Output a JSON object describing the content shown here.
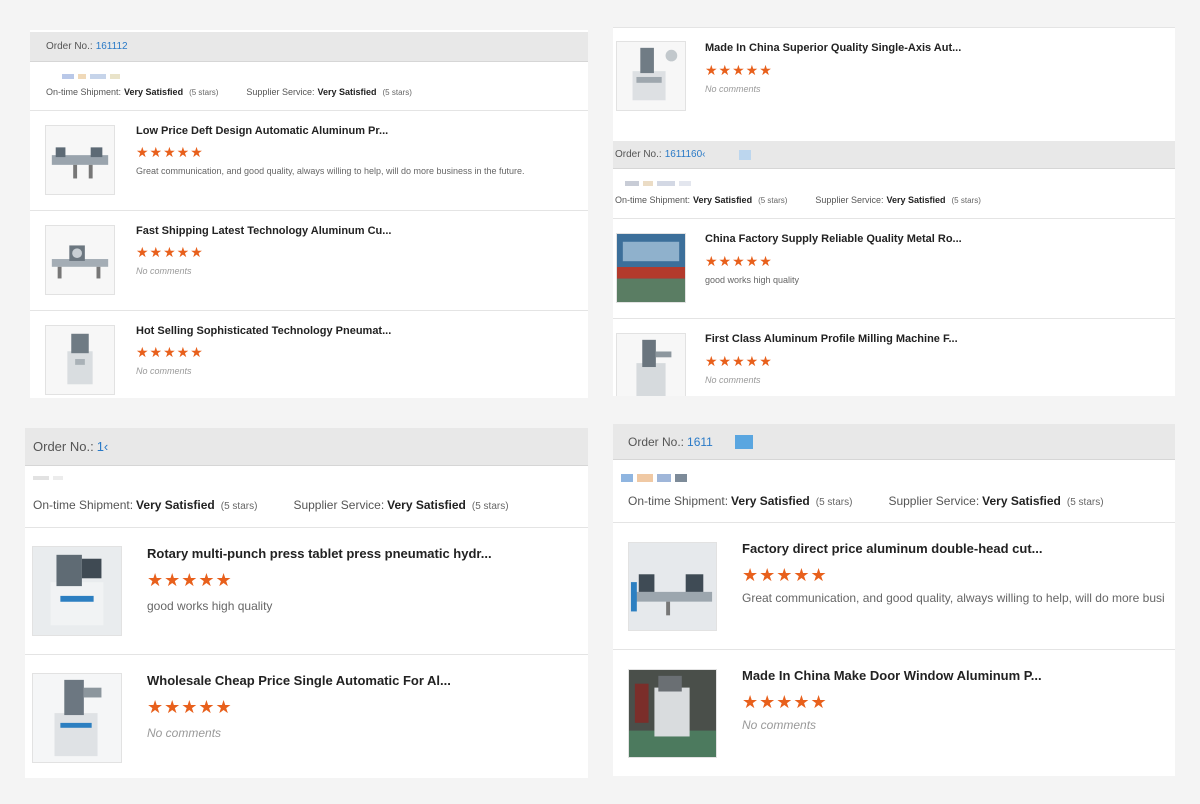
{
  "labels": {
    "order_prefix": "Order No.:",
    "ontime": "On-time Shipment:",
    "supplier": "Supplier Service:",
    "very_satisfied": "Very Satisfied",
    "five_stars": "(5 stars)",
    "star_glyphs": "★★★★★"
  },
  "panel_top_left": {
    "order_number": "161112",
    "items": [
      {
        "title": "Low Price Deft Design Automatic Aluminum Pr...",
        "comment": "Great communication, and good quality, always willing to help, will do more business in the future."
      },
      {
        "title": "Fast Shipping Latest Technology Aluminum Cu...",
        "comment": "No comments"
      },
      {
        "title": "Hot Selling Sophisticated Technology Pneumat...",
        "comment": "No comments"
      }
    ]
  },
  "panel_top_right": {
    "top_item": {
      "title": "Made In China Superior Quality Single-Axis Aut...",
      "comment": "No comments"
    },
    "order_number": "1611160‹",
    "items": [
      {
        "title": "China Factory Supply Reliable Quality Metal Ro...",
        "comment": "good works high quality"
      },
      {
        "title": "First Class Aluminum Profile Milling Machine F...",
        "comment": "No comments"
      }
    ]
  },
  "panel_bottom_left": {
    "order_number": "1‹",
    "items": [
      {
        "title": "Rotary multi-punch press tablet press pneumatic hydr...",
        "comment": "good works high quality"
      },
      {
        "title": "Wholesale Cheap Price Single Automatic For Al...",
        "comment": "No comments"
      }
    ]
  },
  "panel_bottom_right": {
    "order_number": "1611",
    "items": [
      {
        "title": "Factory direct price aluminum double-head cut...",
        "comment": "Great communication, and good quality, always willing to help, will do more busi"
      },
      {
        "title": "Made In China Make Door Window Aluminum P...",
        "comment": "No comments"
      }
    ]
  },
  "colors": {
    "star": "#e8601c",
    "order_link": "#2a7ac7",
    "bar": "#e8e8e8"
  }
}
